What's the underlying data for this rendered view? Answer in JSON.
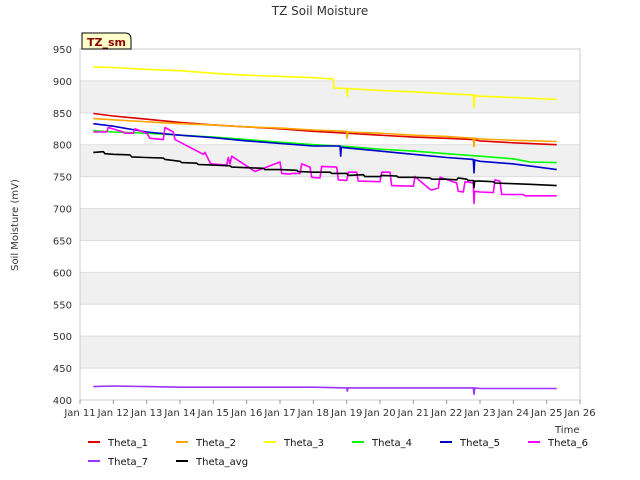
{
  "chart_data": {
    "type": "line",
    "title": "TZ Soil Moisture",
    "xlabel": "Time",
    "ylabel": "Soil Moisture (mV)",
    "site_label": "TZ_sm",
    "xlim": [
      11,
      26
    ],
    "ylim": [
      400,
      950
    ],
    "x_ticks": [
      11,
      12,
      13,
      14,
      15,
      16,
      17,
      18,
      19,
      20,
      21,
      22,
      23,
      24,
      25,
      26
    ],
    "x_tick_labels": [
      "Jan 11",
      "Jan 12",
      "Jan 13",
      "Jan 14",
      "Jan 15",
      "Jan 16",
      "Jan 17",
      "Jan 18",
      "Jan 19",
      "Jan 20",
      "Jan 21",
      "Jan 22",
      "Jan 23",
      "Jan 24",
      "Jan 25",
      "Jan 26"
    ],
    "y_ticks": [
      400,
      450,
      500,
      550,
      600,
      650,
      700,
      750,
      800,
      850,
      900,
      950
    ],
    "grid": true,
    "legend_position": "bottom",
    "series": [
      {
        "name": "Theta_1",
        "color": "#dd0000",
        "x": [
          11.4,
          12,
          13,
          14,
          15,
          16,
          17,
          18,
          19,
          20,
          21,
          22,
          22.8,
          23,
          24,
          25.3
        ],
        "y": [
          849,
          845,
          840,
          835,
          831,
          828,
          825,
          821,
          818,
          815,
          812,
          810,
          808,
          806,
          803,
          800
        ]
      },
      {
        "name": "Theta_2",
        "color": "#ffa500",
        "x": [
          11.4,
          12,
          13,
          14,
          15,
          16,
          17,
          18,
          19,
          19.01,
          19.03,
          20,
          21,
          22,
          22.8,
          22.82,
          22.84,
          23,
          24,
          25.3
        ],
        "y": [
          841,
          839,
          836,
          833,
          831,
          828,
          826,
          823,
          821,
          810,
          820,
          818,
          815,
          813,
          810,
          797,
          810,
          809,
          807,
          805
        ]
      },
      {
        "name": "Theta_3",
        "color": "#ffff00",
        "x": [
          11.4,
          12,
          13,
          14,
          15,
          16,
          17,
          18,
          18.6,
          18.62,
          19,
          19.02,
          19.04,
          20,
          21,
          22,
          22.8,
          22.82,
          22.84,
          23,
          24,
          25.3
        ],
        "y": [
          922,
          921,
          918,
          916,
          912,
          909,
          907,
          905,
          903,
          889,
          888,
          876,
          888,
          885,
          883,
          880,
          878,
          858,
          877,
          876,
          874,
          871
        ]
      },
      {
        "name": "Theta_4",
        "color": "#00ff00",
        "x": [
          11.4,
          12,
          13,
          14,
          15,
          16,
          17,
          18,
          19,
          20,
          21,
          22,
          23,
          24,
          24.5,
          25.3
        ],
        "y": [
          822,
          820,
          818,
          815,
          812,
          808,
          804,
          800,
          797,
          793,
          790,
          786,
          782,
          778,
          773,
          772
        ]
      },
      {
        "name": "Theta_5",
        "color": "#0000cc",
        "x": [
          11.4,
          12,
          13,
          14,
          15,
          16,
          17,
          18,
          18.8,
          18.82,
          18.84,
          19,
          20,
          21,
          22,
          22.8,
          22.82,
          22.84,
          23,
          24,
          24.6,
          25.3
        ],
        "y": [
          833,
          829,
          820,
          815,
          811,
          806,
          802,
          798,
          798,
          782,
          796,
          795,
          790,
          785,
          780,
          777,
          756,
          776,
          774,
          770,
          766,
          761
        ]
      },
      {
        "name": "Theta_6",
        "color": "#ff00ff",
        "x": [
          11.4,
          11.8,
          11.85,
          12.3,
          12.35,
          12.6,
          12.65,
          13.0,
          13.1,
          13.5,
          13.55,
          13.8,
          13.85,
          14.7,
          14.75,
          14.9,
          14.95,
          15.4,
          15.45,
          15.5,
          15.55,
          16.2,
          16.25,
          17.0,
          17.05,
          17.3,
          17.35,
          17.6,
          17.65,
          17.9,
          17.95,
          18.2,
          18.25,
          18.7,
          18.75,
          19.0,
          19.05,
          19.3,
          19.35,
          20.0,
          20.05,
          20.3,
          20.35,
          21.0,
          21.05,
          21.5,
          21.55,
          21.75,
          21.8,
          22.3,
          22.35,
          22.5,
          22.55,
          22.8,
          22.82,
          22.84,
          23.0,
          23.4,
          23.45,
          23.6,
          23.65,
          24.3,
          24.35,
          25.3
        ],
        "y": [
          820,
          820,
          827,
          820,
          818,
          818,
          825,
          818,
          810,
          808,
          827,
          820,
          808,
          785,
          788,
          772,
          770,
          768,
          780,
          770,
          782,
          760,
          758,
          773,
          755,
          754,
          755,
          755,
          770,
          765,
          749,
          748,
          766,
          765,
          745,
          744,
          757,
          757,
          743,
          742,
          757,
          757,
          736,
          735,
          750,
          730,
          729,
          732,
          749,
          740,
          727,
          726,
          742,
          740,
          708,
          727,
          726,
          725,
          745,
          743,
          722,
          722,
          720,
          720
        ]
      },
      {
        "name": "Theta_7",
        "color": "#9933ff",
        "x": [
          11.4,
          12,
          13,
          14,
          15,
          16,
          17,
          18,
          19,
          19.02,
          19.04,
          20,
          21,
          22,
          22.8,
          22.82,
          22.84,
          23,
          24,
          25.3
        ],
        "y": [
          421,
          422,
          421,
          420,
          420,
          420,
          420,
          420,
          419,
          414,
          419,
          419,
          419,
          419,
          419,
          409,
          419,
          418,
          418,
          418
        ]
      },
      {
        "name": "Theta_avg",
        "color": "#000000",
        "x": [
          11.4,
          11.7,
          11.75,
          12,
          12.5,
          12.55,
          13,
          13.5,
          13.55,
          14.0,
          14.05,
          14.5,
          14.55,
          15,
          15.5,
          15.55,
          16,
          16.5,
          16.55,
          17,
          17.5,
          17.55,
          18,
          18.5,
          18.55,
          19,
          19.05,
          19.5,
          19.55,
          20.0,
          20.05,
          20.5,
          20.55,
          21,
          21.5,
          21.55,
          22,
          22.3,
          22.35,
          22.6,
          22.65,
          22.8,
          22.82,
          22.84,
          23.0,
          23.4,
          23.45,
          24,
          24.5,
          25.3
        ],
        "y": [
          788,
          789,
          786,
          785,
          784,
          781,
          780,
          779,
          777,
          774,
          772,
          771,
          769,
          768,
          767,
          765,
          764,
          763,
          761,
          761,
          760,
          758,
          757,
          757,
          755,
          755,
          752,
          753,
          750,
          750,
          752,
          751,
          749,
          749,
          748,
          746,
          746,
          745,
          748,
          746,
          744,
          744,
          733,
          743,
          743,
          742,
          740,
          739,
          738,
          736
        ]
      }
    ]
  }
}
